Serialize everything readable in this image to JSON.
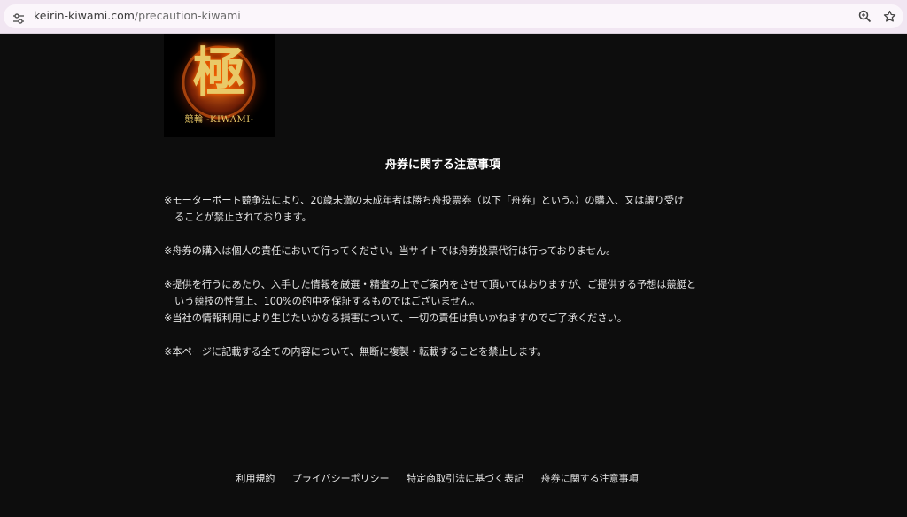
{
  "browser": {
    "url_domain": "keirin-kiwami.com",
    "url_path": "/precaution-kiwami",
    "icons": [
      "tune-icon",
      "zoom-icon",
      "star-icon"
    ]
  },
  "logo": {
    "kanji": "極",
    "subtitle": "競輪 -KIWAMI-"
  },
  "page": {
    "title": "舟券に関する注意事項",
    "para1_line1": "※モーターボート競争法により、20歳未満の未成年者は勝ち舟投票券（以下「舟券」という。）の購入、又は譲り受け",
    "para1_line2": "ることが禁止されております。",
    "para2_line1": "※舟券の購入は個人の責任において行ってください。当サイトでは舟券投票代行は行っておりません。",
    "para3_line1": "※提供を行うにあたり、入手した情報を厳選・精査の上でご案内をさせて頂いてはおりますが、ご提供する予想は競艇と",
    "para3_line2": "いう競技の性質上、100%の的中を保証するものではございません。",
    "para3_line3": "※当社の情報利用により生じたいかなる損害について、一切の責任は負いかねますのでご了承ください。",
    "para4_line1": "※本ページに記載する全ての内容について、無断に複製・転載することを禁止します。"
  },
  "footer": {
    "links": [
      "利用規約",
      "プライバシーポリシー",
      "特定商取引法に基づく表記",
      "舟券に関する注意事項"
    ]
  }
}
